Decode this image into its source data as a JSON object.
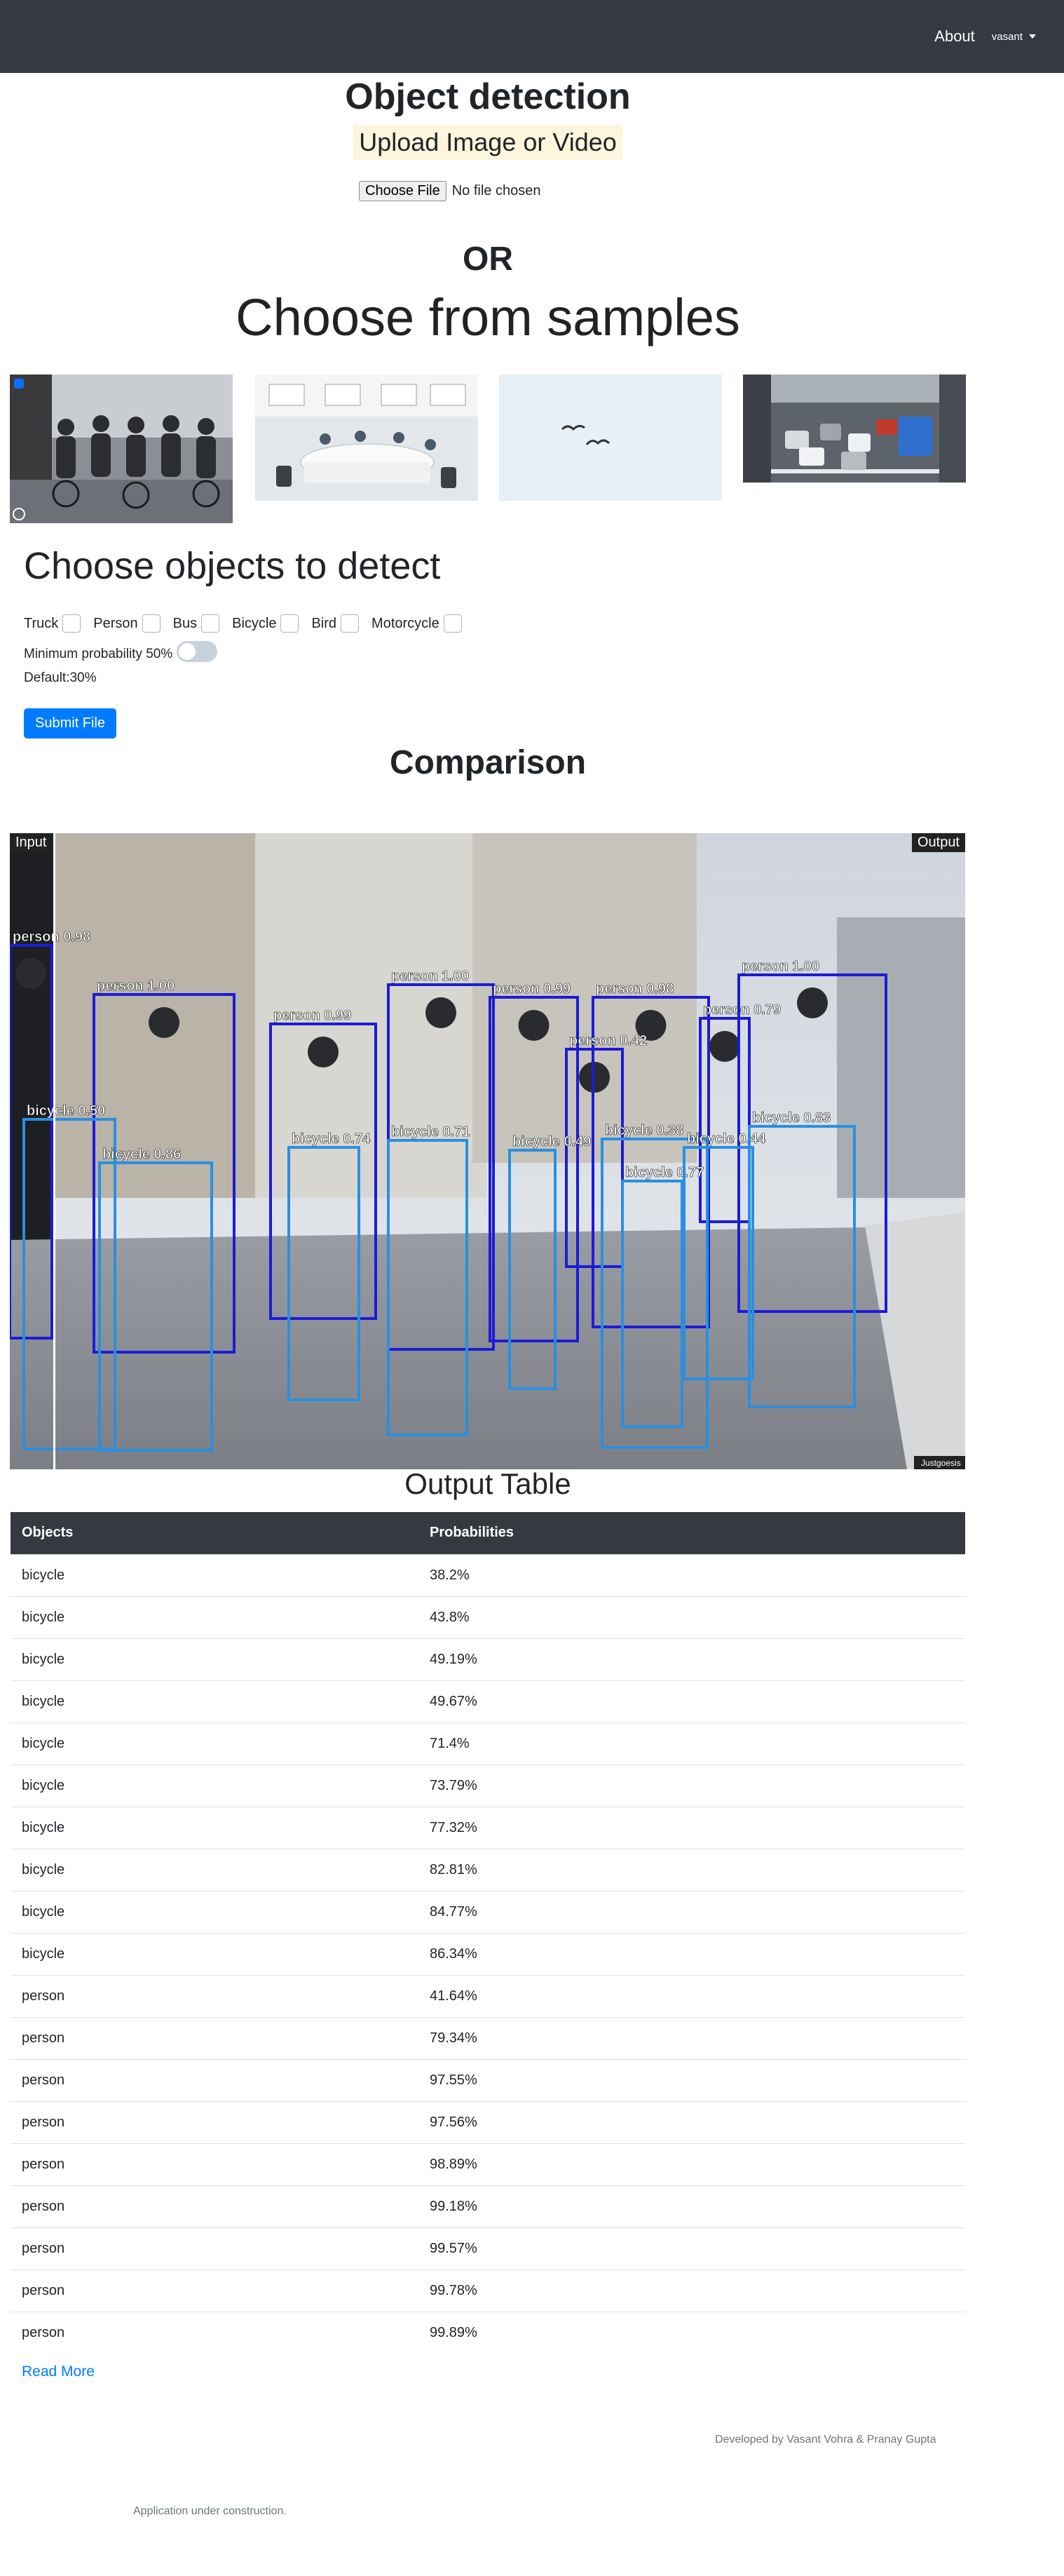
{
  "nav": {
    "about": "About",
    "user": "vasant"
  },
  "page": {
    "title": "Object detection",
    "upload_label": "Upload Image or Video",
    "choose_file": "Choose File",
    "file_status": "No file chosen",
    "or": "OR",
    "samples_heading": "Choose from samples"
  },
  "samples": [
    {
      "name": "cyclists"
    },
    {
      "name": "office"
    },
    {
      "name": "birds"
    },
    {
      "name": "traffic"
    }
  ],
  "objects": {
    "heading": "Choose objects to detect",
    "items": [
      "Truck",
      "Person",
      "Bus",
      "Bicycle",
      "Bird",
      "Motorcycle"
    ],
    "min_prob_label": "Minimum probability 50%",
    "default_label": "Default:30%",
    "min_prob_enabled": false
  },
  "submit_label": "Submit File",
  "comparison": {
    "heading": "Comparison",
    "input_label": "Input",
    "output_label": "Output",
    "detections": [
      {
        "label": "person 0.98"
      },
      {
        "label": "person 1.00"
      },
      {
        "label": "person 0.99"
      },
      {
        "label": "person 1.00"
      },
      {
        "label": "person 0.99"
      },
      {
        "label": "person 0.98"
      },
      {
        "label": "person 0.42"
      },
      {
        "label": "person 0.79"
      },
      {
        "label": "person 1.00"
      },
      {
        "label": "bicycle 0.50"
      },
      {
        "label": "bicycle 0.86"
      },
      {
        "label": "bicycle 0.74"
      },
      {
        "label": "bicycle 0.71"
      },
      {
        "label": "bicycle 0.49"
      },
      {
        "label": "bicycle 0.38"
      },
      {
        "label": "bicycle 0.77"
      },
      {
        "label": "bicycle 0.44"
      },
      {
        "label": "bicycle 0.83"
      }
    ],
    "watermark": "Justgoesis"
  },
  "table": {
    "heading": "Output Table",
    "columns": [
      "Objects",
      "Probabilities"
    ],
    "rows": [
      [
        "bicycle",
        "38.2%"
      ],
      [
        "bicycle",
        "43.8%"
      ],
      [
        "bicycle",
        "49.19%"
      ],
      [
        "bicycle",
        "49.67%"
      ],
      [
        "bicycle",
        "71.4%"
      ],
      [
        "bicycle",
        "73.79%"
      ],
      [
        "bicycle",
        "77.32%"
      ],
      [
        "bicycle",
        "82.81%"
      ],
      [
        "bicycle",
        "84.77%"
      ],
      [
        "bicycle",
        "86.34%"
      ],
      [
        "person",
        "41.64%"
      ],
      [
        "person",
        "79.34%"
      ],
      [
        "person",
        "97.55%"
      ],
      [
        "person",
        "97.56%"
      ],
      [
        "person",
        "98.89%"
      ],
      [
        "person",
        "99.18%"
      ],
      [
        "person",
        "99.57%"
      ],
      [
        "person",
        "99.78%"
      ],
      [
        "person",
        "99.89%"
      ]
    ]
  },
  "read_more": "Read More",
  "developed_by": "Developed by Vasant Vohra & Pranay Gupta",
  "construction_note": "Application under construction."
}
